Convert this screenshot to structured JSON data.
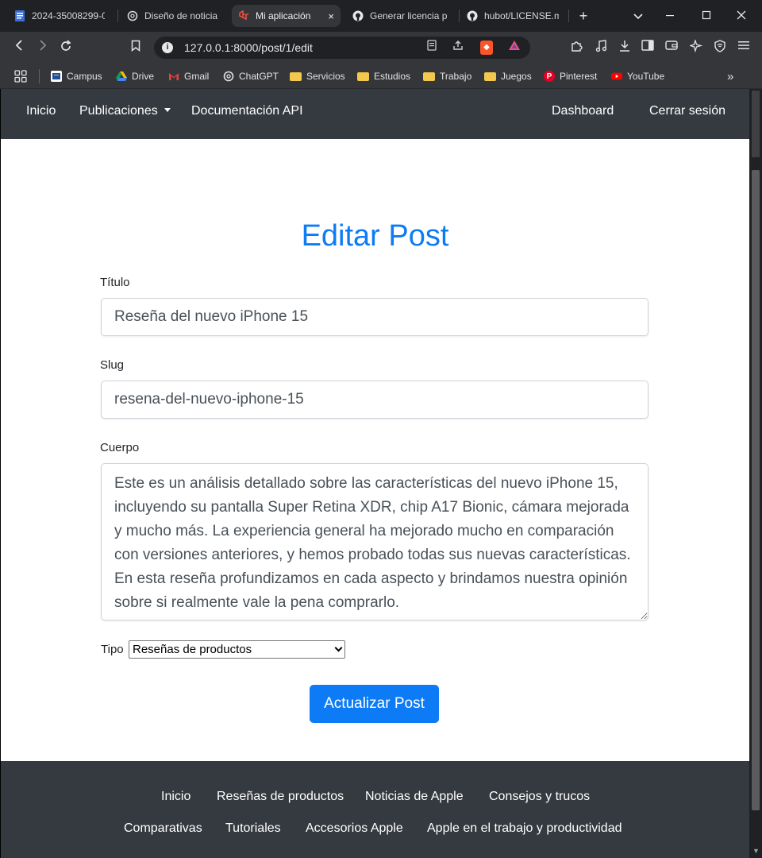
{
  "browser": {
    "tabs": [
      {
        "label": "2024-35008299-0",
        "icon": "document-icon",
        "active": false
      },
      {
        "label": "Diseño de noticia",
        "icon": "openai-icon",
        "active": false
      },
      {
        "label": "Mi aplicación",
        "icon": "laravel-icon",
        "active": true
      },
      {
        "label": "Generar licencia p",
        "icon": "github-icon",
        "active": false
      },
      {
        "label": "hubot/LICENSE.m",
        "icon": "github-icon",
        "active": false
      }
    ],
    "new_tab": "+",
    "close_tab": "×",
    "url": "127.0.0.1:8000/post/1/edit",
    "bookmarks": [
      {
        "label": "Campus",
        "icon": "campus-icon"
      },
      {
        "label": "Drive",
        "icon": "drive-icon"
      },
      {
        "label": "Gmail",
        "icon": "gmail-icon"
      },
      {
        "label": "ChatGPT",
        "icon": "openai-icon"
      },
      {
        "label": "Servicios",
        "icon": "folder-icon"
      },
      {
        "label": "Estudios",
        "icon": "folder-icon"
      },
      {
        "label": "Trabajo",
        "icon": "folder-icon"
      },
      {
        "label": "Juegos",
        "icon": "folder-icon"
      },
      {
        "label": "Pinterest",
        "icon": "pinterest-icon"
      },
      {
        "label": "YouTube",
        "icon": "youtube-icon"
      }
    ],
    "bookmarks_more": "»"
  },
  "navbar": {
    "home": "Inicio",
    "publications": "Publicaciones",
    "api_docs": "Documentación API",
    "dashboard": "Dashboard",
    "logout": "Cerrar sesión"
  },
  "form": {
    "title": "Editar Post",
    "titulo_label": "Título",
    "titulo_value": "Reseña del nuevo iPhone 15",
    "slug_label": "Slug",
    "slug_value": "resena-del-nuevo-iphone-15",
    "cuerpo_label": "Cuerpo",
    "cuerpo_value": "Este es un análisis detallado sobre las características del nuevo iPhone 15, incluyendo su pantalla Super Retina XDR, chip A17 Bionic, cámara mejorada y mucho más. La experiencia general ha mejorado mucho en comparación con versiones anteriores, y hemos probado todas sus nuevas características. En esta reseña profundizamos en cada aspecto y brindamos nuestra opinión sobre si realmente vale la pena comprarlo.",
    "tipo_label": "Tipo",
    "tipo_value": "Reseñas de productos",
    "submit": "Actualizar Post"
  },
  "footer": {
    "row1": [
      "Inicio",
      "Reseñas de productos",
      "Noticias de Apple",
      "Consejos y trucos"
    ],
    "row2": [
      "Comparativas",
      "Tutoriales",
      "Accesorios Apple",
      "Apple en el trabajo y productividad"
    ]
  },
  "colors": {
    "primary": "#0d7bf5",
    "navbar_bg": "#343a40",
    "browser_bg": "#202124"
  }
}
